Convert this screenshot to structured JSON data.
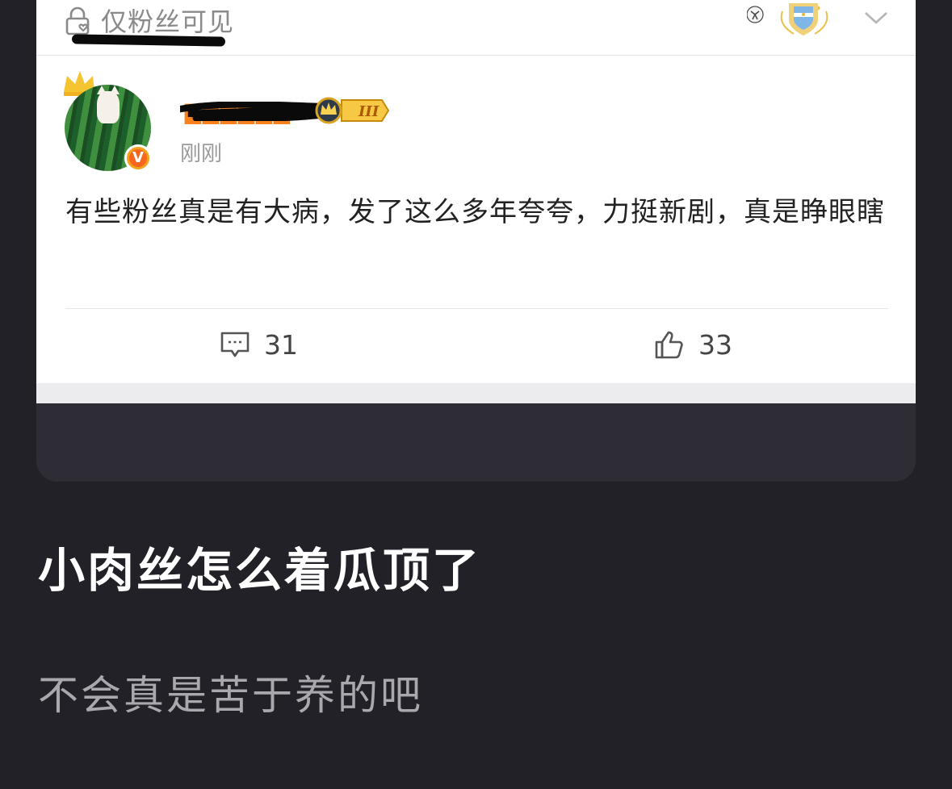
{
  "post_card": {
    "visibility_label": "仅粉丝可见",
    "post": {
      "timestamp": "刚刚",
      "level_badge": "III",
      "verified_mark": "V",
      "text": "有些粉丝真是有大病，发了这么多年夸夸，力挺新剧，真是睁眼瞎",
      "comment_count": "31",
      "like_count": "33"
    }
  },
  "caption": {
    "headline": "小肉丝怎么着瓜顶了",
    "subtext": "不会真是苦于养的吧"
  },
  "colors": {
    "page_background": "#222128",
    "card_background": "#ffffff",
    "username_color": "#f7821d",
    "verified_badge": "#f6671d"
  },
  "icons": [
    "lock-heart-icon",
    "emblem-icon",
    "chevron-down-icon",
    "crown-icon",
    "comment-icon",
    "like-icon"
  ]
}
